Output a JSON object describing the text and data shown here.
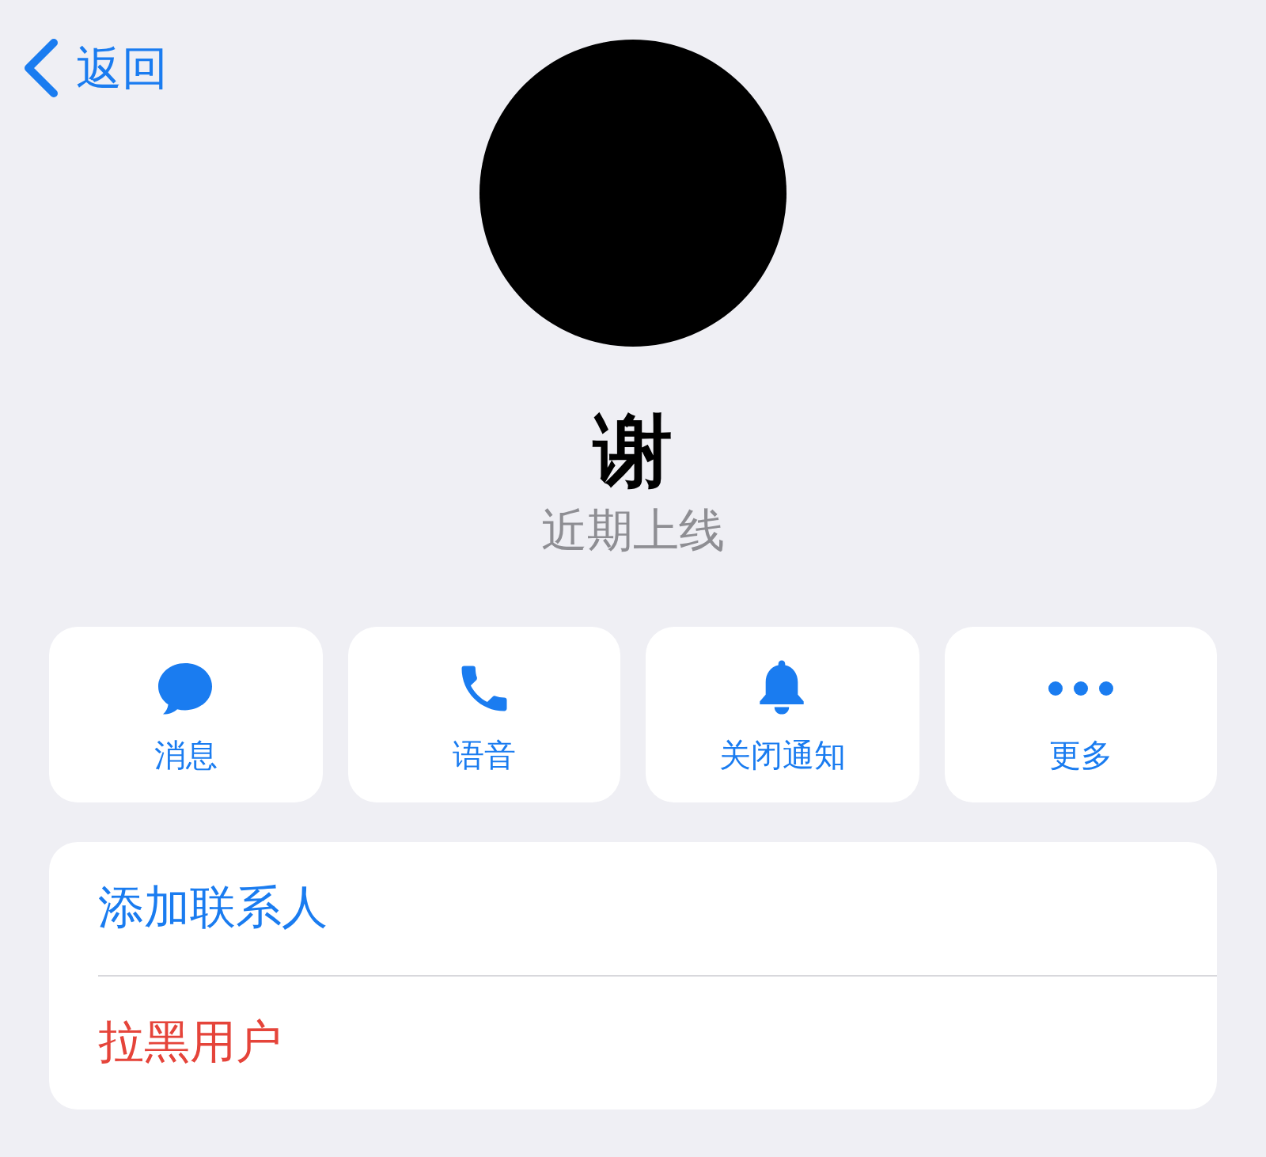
{
  "nav": {
    "back_label": "返回"
  },
  "profile": {
    "name": "谢",
    "status": "近期上线"
  },
  "actions": [
    {
      "kind": "message",
      "label": "消息"
    },
    {
      "kind": "call",
      "label": "语音"
    },
    {
      "kind": "mute",
      "label": "关闭通知"
    },
    {
      "kind": "more",
      "label": "更多"
    }
  ],
  "menu": [
    {
      "kind": "normal",
      "label": "添加联系人"
    },
    {
      "kind": "destructive",
      "label": "拉黑用户"
    }
  ]
}
